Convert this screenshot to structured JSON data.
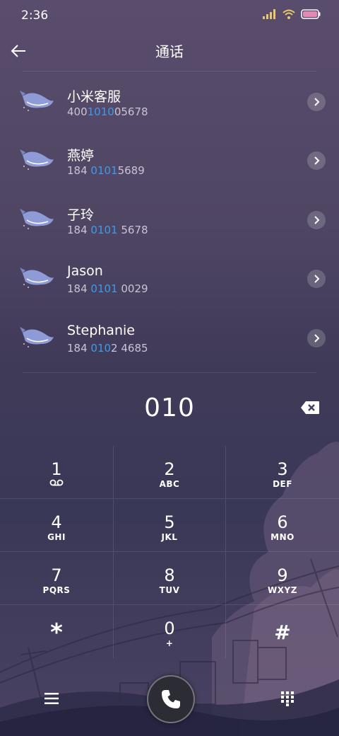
{
  "status_bar": {
    "time": "2:36",
    "icons": [
      "signal-icon",
      "wifi-icon",
      "battery-icon"
    ]
  },
  "header": {
    "title": "通话",
    "back_icon": "arrow-left-icon"
  },
  "search_query": "010",
  "contacts": [
    {
      "name": "小米客服",
      "number_before": "400",
      "number_match": "1010",
      "number_after": "05678"
    },
    {
      "name": "燕婷",
      "number_before": "184 ",
      "number_match": "0101",
      "number_after": "5689"
    },
    {
      "name": "子玲",
      "number_before": "184 ",
      "number_match": "0101",
      "number_after": " 5678"
    },
    {
      "name": "Jason",
      "number_before": "184 ",
      "number_match": "0101",
      "number_after": " 0029"
    },
    {
      "name": "Stephanie",
      "number_before": "184 ",
      "number_match": "010",
      "number_after": "2 4685"
    }
  ],
  "keypad": [
    {
      "digit": "1",
      "letters": "",
      "icon": "voicemail-icon"
    },
    {
      "digit": "2",
      "letters": "ABC"
    },
    {
      "digit": "3",
      "letters": "DEF"
    },
    {
      "digit": "4",
      "letters": "GHI"
    },
    {
      "digit": "5",
      "letters": "JKL"
    },
    {
      "digit": "6",
      "letters": "MNO"
    },
    {
      "digit": "7",
      "letters": "PQRS"
    },
    {
      "digit": "8",
      "letters": "TUV"
    },
    {
      "digit": "9",
      "letters": "WXYZ"
    },
    {
      "digit": "*",
      "letters": ""
    },
    {
      "digit": "0",
      "letters": "+"
    },
    {
      "digit": "#",
      "letters": ""
    }
  ],
  "colors": {
    "match_highlight": "#3d9be9",
    "background_top": "#5a4c6c",
    "background_bottom": "#3a3857"
  },
  "bottom_bar": {
    "menu_icon": "menu-icon",
    "call_icon": "phone-icon",
    "keypad_icon": "dialpad-icon"
  }
}
